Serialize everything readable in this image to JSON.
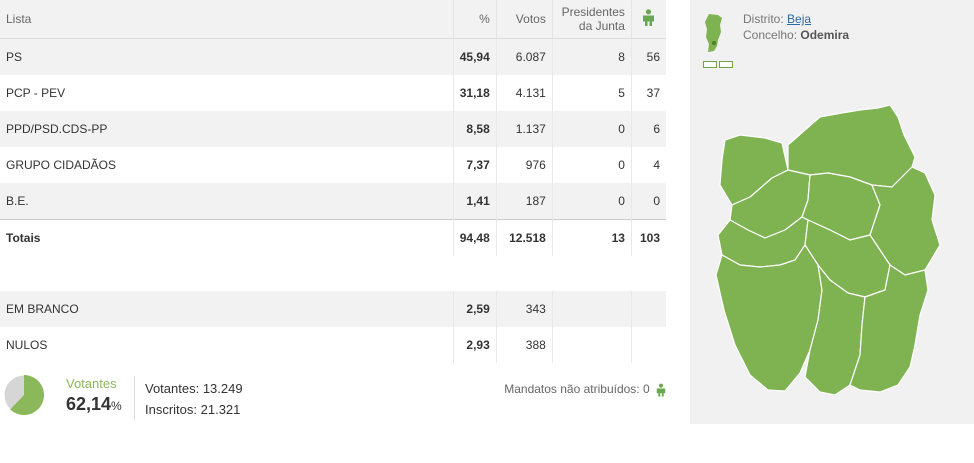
{
  "table": {
    "headers": {
      "list": "Lista",
      "pct": "%",
      "votes": "Votos",
      "presidents": "Presidentes da Junta",
      "mandates_icon": "person-icon"
    },
    "rows": [
      {
        "list": "PS",
        "pct": "45,94",
        "votes": "6.087",
        "presidents": "8",
        "mandates": "56"
      },
      {
        "list": "PCP - PEV",
        "pct": "31,18",
        "votes": "4.131",
        "presidents": "5",
        "mandates": "37"
      },
      {
        "list": "PPD/PSD.CDS-PP",
        "pct": "8,58",
        "votes": "1.137",
        "presidents": "0",
        "mandates": "6"
      },
      {
        "list": "GRUPO CIDADÃOS",
        "pct": "7,37",
        "votes": "976",
        "presidents": "0",
        "mandates": "4"
      },
      {
        "list": "B.E.",
        "pct": "1,41",
        "votes": "187",
        "presidents": "0",
        "mandates": "0"
      }
    ],
    "totals": {
      "label": "Totais",
      "pct": "94,48",
      "votes": "12.518",
      "presidents": "13",
      "mandates": "103"
    },
    "blank": {
      "label": "EM BRANCO",
      "pct": "2,59",
      "votes": "343"
    },
    "null": {
      "label": "NULOS",
      "pct": "2,93",
      "votes": "388"
    }
  },
  "footer": {
    "turnout_label": "Votantes",
    "turnout_value": "62,14",
    "turnout_unit": "%",
    "turnout_fraction": 0.6214,
    "voters": "Votantes: 13.249",
    "registered": "Inscritos: 21.321",
    "unassigned": "Mandatos não atribuídos: 0"
  },
  "location": {
    "district_label": "Distrito:",
    "district": "Beja",
    "municipality_label": "Concelho:",
    "municipality": "Odemira"
  },
  "colors": {
    "accent": "#8ab85a",
    "map_fill": "#7fb352",
    "pie_other": "#d6d6d6"
  }
}
